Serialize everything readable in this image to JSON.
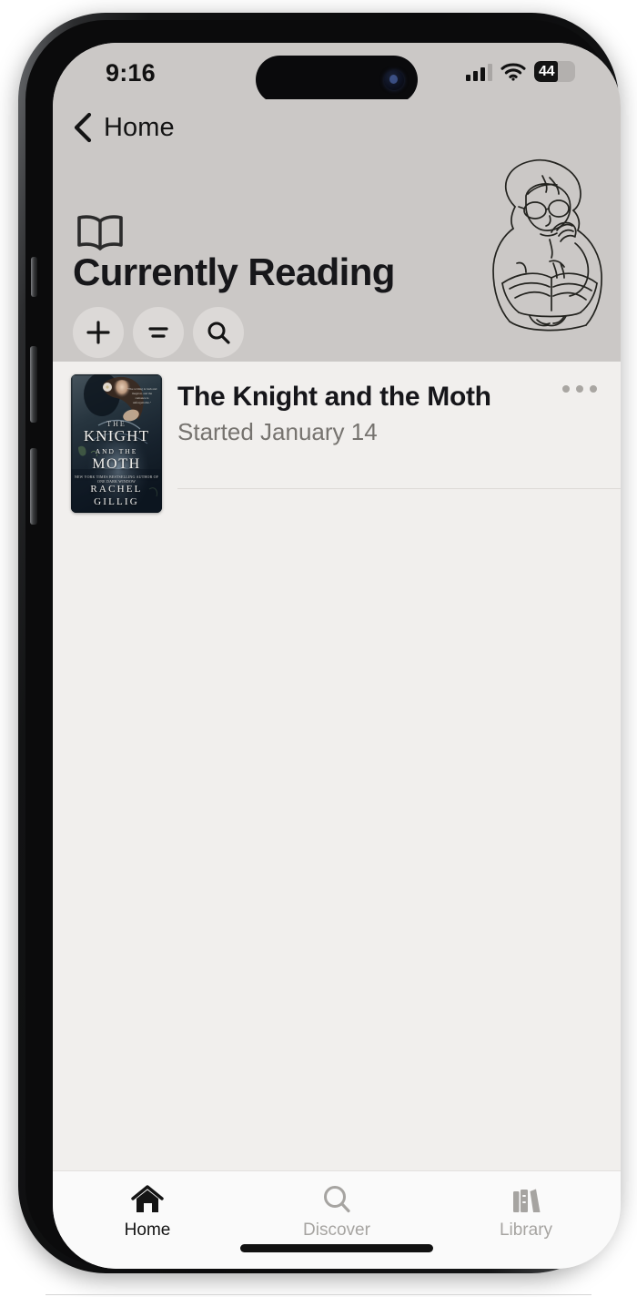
{
  "status_bar": {
    "time": "9:16",
    "signal_icon": "cellular-signal-icon",
    "wifi_icon": "wifi-icon",
    "battery_percent": "44",
    "battery_icon": "battery-icon"
  },
  "nav": {
    "back_icon": "chevron-left-icon",
    "back_label": "Home"
  },
  "header": {
    "icon": "open-book-icon",
    "title": "Currently Reading",
    "illustration": "reading-person-illustration",
    "actions": [
      {
        "name": "add-button",
        "icon": "plus-icon"
      },
      {
        "name": "sort-button",
        "icon": "sort-lines-icon"
      },
      {
        "name": "search-button",
        "icon": "search-icon"
      }
    ]
  },
  "books": [
    {
      "title": "The Knight and the Moth",
      "subtitle": "Started January 14",
      "more_icon": "more-horizontal-icon",
      "cover": {
        "line_the": "THE",
        "line_knight": "KNIGHT",
        "line_and_the": "AND THE",
        "line_moth": "MOTH",
        "blurb": "NEW YORK TIMES BESTSELLING AUTHOR OF ONE DARK WINDOW",
        "author_first": "RACHEL",
        "author_last": "GILLIG",
        "quote": "\"The writing is lush and magical, and the romance is unforgettable.\"",
        "colors": {
          "dark": "#121c27",
          "mid": "#2e3c46"
        }
      }
    }
  ],
  "tabs": [
    {
      "label": "Home",
      "icon": "home-icon",
      "active": true
    },
    {
      "label": "Discover",
      "icon": "search-icon",
      "active": false
    },
    {
      "label": "Library",
      "icon": "books-shelf-icon",
      "active": false
    }
  ],
  "colors": {
    "header_bg": "#cbc8c6",
    "content_bg": "#f1efed",
    "tabbar_bg": "#fafafa",
    "text_primary": "#16161a",
    "text_muted": "#76736f"
  }
}
